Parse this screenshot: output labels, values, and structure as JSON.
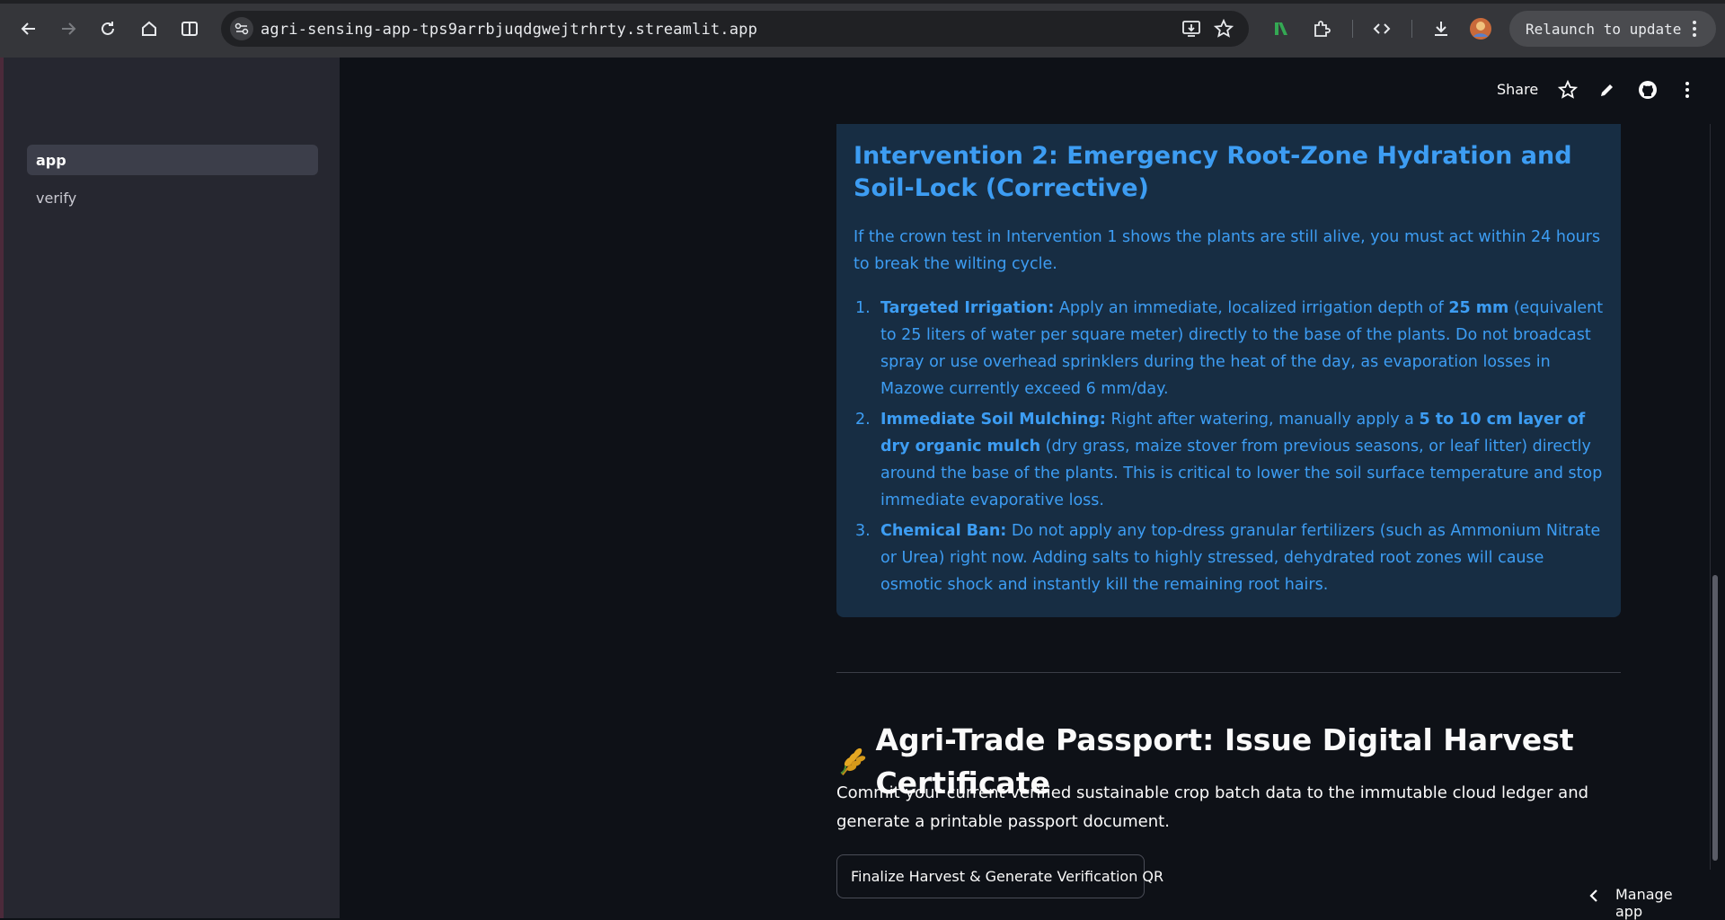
{
  "browser": {
    "url": "agri-sensing-app-tps9arrbjuqdgwejtrhrty.streamlit.app",
    "relaunch_label": "Relaunch to update"
  },
  "sidebar": {
    "items": [
      {
        "label": "app",
        "active": true
      },
      {
        "label": "verify",
        "active": false
      }
    ]
  },
  "header": {
    "share_label": "Share"
  },
  "intervention": {
    "title": "Intervention 2: Emergency Root-Zone Hydration and Soil-Lock (Corrective)",
    "intro": "If the crown test in Intervention 1 shows the plants are still alive, you must act within 24 hours to break the wilting cycle.",
    "steps": [
      {
        "num": "1.",
        "lead": "Targeted Irrigation:",
        "t1": " Apply an immediate, localized irrigation depth of ",
        "b1": "25 mm",
        "t2": " (equivalent to 25 liters of water per square meter) directly to the base of the plants. Do not broadcast spray or use overhead sprinklers during the heat of the day, as evaporation losses in Mazowe currently exceed 6 mm/day."
      },
      {
        "num": "2.",
        "lead": "Immediate Soil Mulching:",
        "t1": " Right after watering, manually apply a ",
        "b1": "5 to 10 cm layer of dry organic mulch",
        "t2": " (dry grass, maize stover from previous seasons, or leaf litter) directly around the base of the plants. This is critical to lower the soil surface temperature and stop immediate evaporative loss."
      },
      {
        "num": "3.",
        "lead": "Chemical Ban:",
        "t1": " Do not apply any top-dress granular fertilizers (such as Ammonium Nitrate or Urea) right now. Adding salts to highly stressed, dehydrated root zones will cause osmotic shock and instantly kill the remaining root hairs.",
        "b1": "",
        "t2": ""
      }
    ]
  },
  "passport": {
    "title": "Agri-Trade Passport: Issue Digital Harvest Certificate",
    "description": "Commit your current verified sustainable crop batch data to the immutable cloud ledger and generate a printable passport document.",
    "button_label": "Finalize Harvest & Generate Verification QR"
  },
  "footer": {
    "manage_app_label": "Manage app"
  }
}
